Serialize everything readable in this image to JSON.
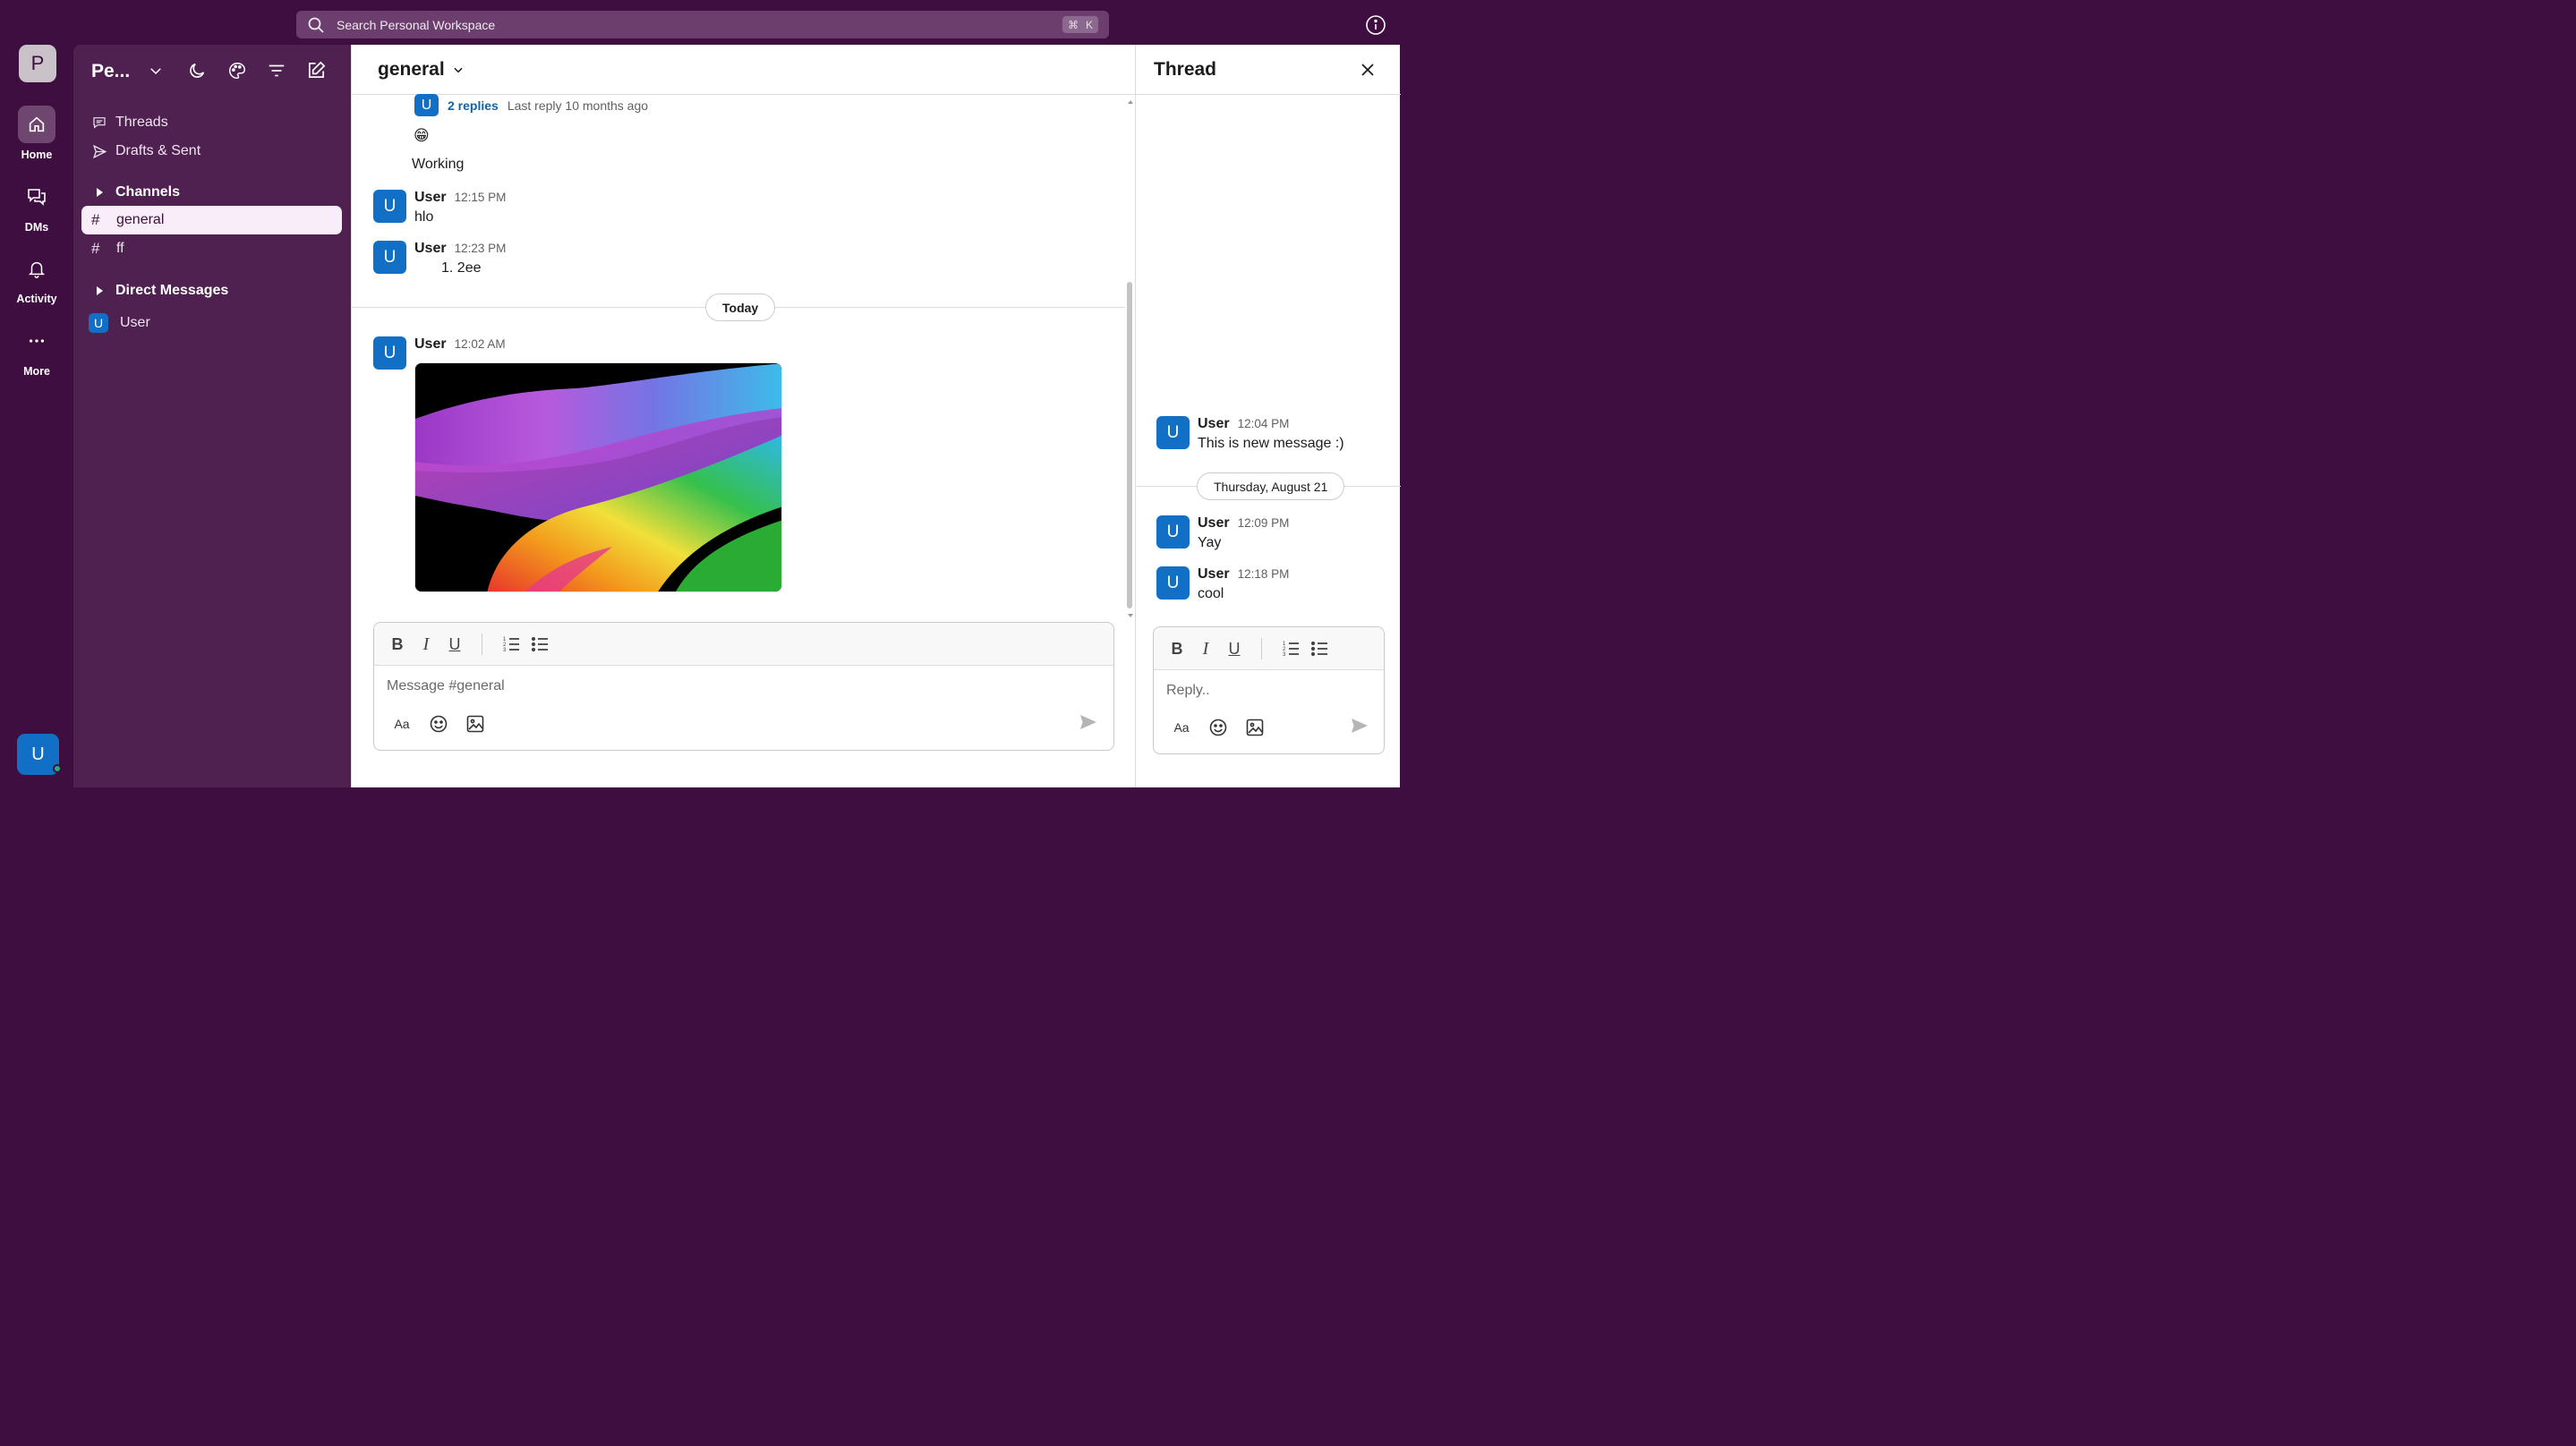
{
  "search": {
    "placeholder": "Search Personal Workspace",
    "shortcut_cmd": "⌘",
    "shortcut_key": "K"
  },
  "workspace": {
    "initial": "P",
    "name": "Pe..."
  },
  "rail": [
    {
      "label": "Home",
      "icon": "home-icon"
    },
    {
      "label": "DMs",
      "icon": "dms-icon"
    },
    {
      "label": "Activity",
      "icon": "bell-icon"
    },
    {
      "label": "More",
      "icon": "more-icon"
    }
  ],
  "current_user": {
    "initial": "U"
  },
  "sidebar": {
    "threads": "Threads",
    "drafts": "Drafts & Sent",
    "channels_heading": "Channels",
    "channels": [
      {
        "hash": "#",
        "name": "general",
        "active": true
      },
      {
        "hash": "#",
        "name": "ff",
        "active": false
      }
    ],
    "dm_heading": "Direct Messages",
    "dms": [
      {
        "initial": "U",
        "name": "User"
      }
    ]
  },
  "channel": {
    "name": "general",
    "replies": {
      "initial": "U",
      "count": "2 replies",
      "last": "Last reply 10 months ago"
    },
    "emoji": "😁",
    "working": "Working",
    "messages": [
      {
        "initial": "U",
        "author": "User",
        "time": "12:15 PM",
        "text": "hlo"
      },
      {
        "initial": "U",
        "author": "User",
        "time": "12:23 PM",
        "text": "1. 2ee"
      },
      {
        "initial": "U",
        "author": "User",
        "time": "12:02 AM",
        "text": ""
      }
    ],
    "day_divider": "Today",
    "composer_placeholder": "Message #general"
  },
  "thread": {
    "title": "Thread",
    "messages": [
      {
        "initial": "U",
        "author": "User",
        "time": "12:04 PM",
        "text": "This is new message :)"
      },
      {
        "initial": "U",
        "author": "User",
        "time": "12:09 PM",
        "text": "Yay"
      },
      {
        "initial": "U",
        "author": "User",
        "time": "12:18 PM",
        "text": "cool"
      }
    ],
    "day_divider": "Thursday, August 21",
    "reply_placeholder": "Reply.."
  },
  "toolbar": {
    "bold": "B",
    "italic": "I",
    "underline": "U",
    "format": "Aa"
  }
}
